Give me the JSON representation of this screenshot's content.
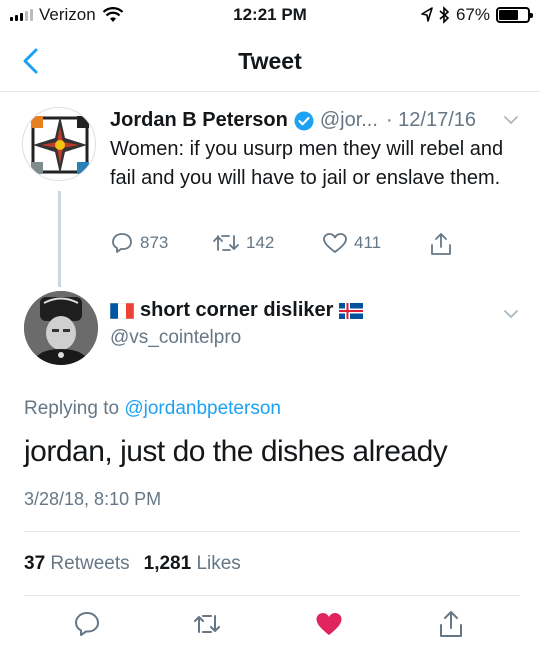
{
  "status_bar": {
    "carrier": "Verizon",
    "time": "12:21 PM",
    "battery": "67%",
    "battery_level": 0.67
  },
  "nav": {
    "title": "Tweet"
  },
  "parent_tweet": {
    "display_name": "Jordan B Peterson",
    "handle": "@jor...",
    "date": "· 12/17/16",
    "text": "Women: if you usurp men they will rebel and fail and you will have to jail or enslave them.",
    "replies": "873",
    "retweets": "142",
    "likes": "411"
  },
  "main_tweet": {
    "display_name": "short corner disliker",
    "handle": "@vs_cointelpro",
    "replying_prefix": "Replying to",
    "replying_handle": "@jordanbpeterson",
    "text": "jordan, just do the dishes already",
    "timestamp": "3/28/18, 8:10 PM",
    "retweet_count": "37",
    "retweet_label": "Retweets",
    "like_count": "1,281",
    "like_label": "Likes",
    "liked": true
  },
  "colors": {
    "accent": "#1da1f2",
    "like": "#e0245e",
    "muted": "#657786",
    "text": "#14171a"
  }
}
